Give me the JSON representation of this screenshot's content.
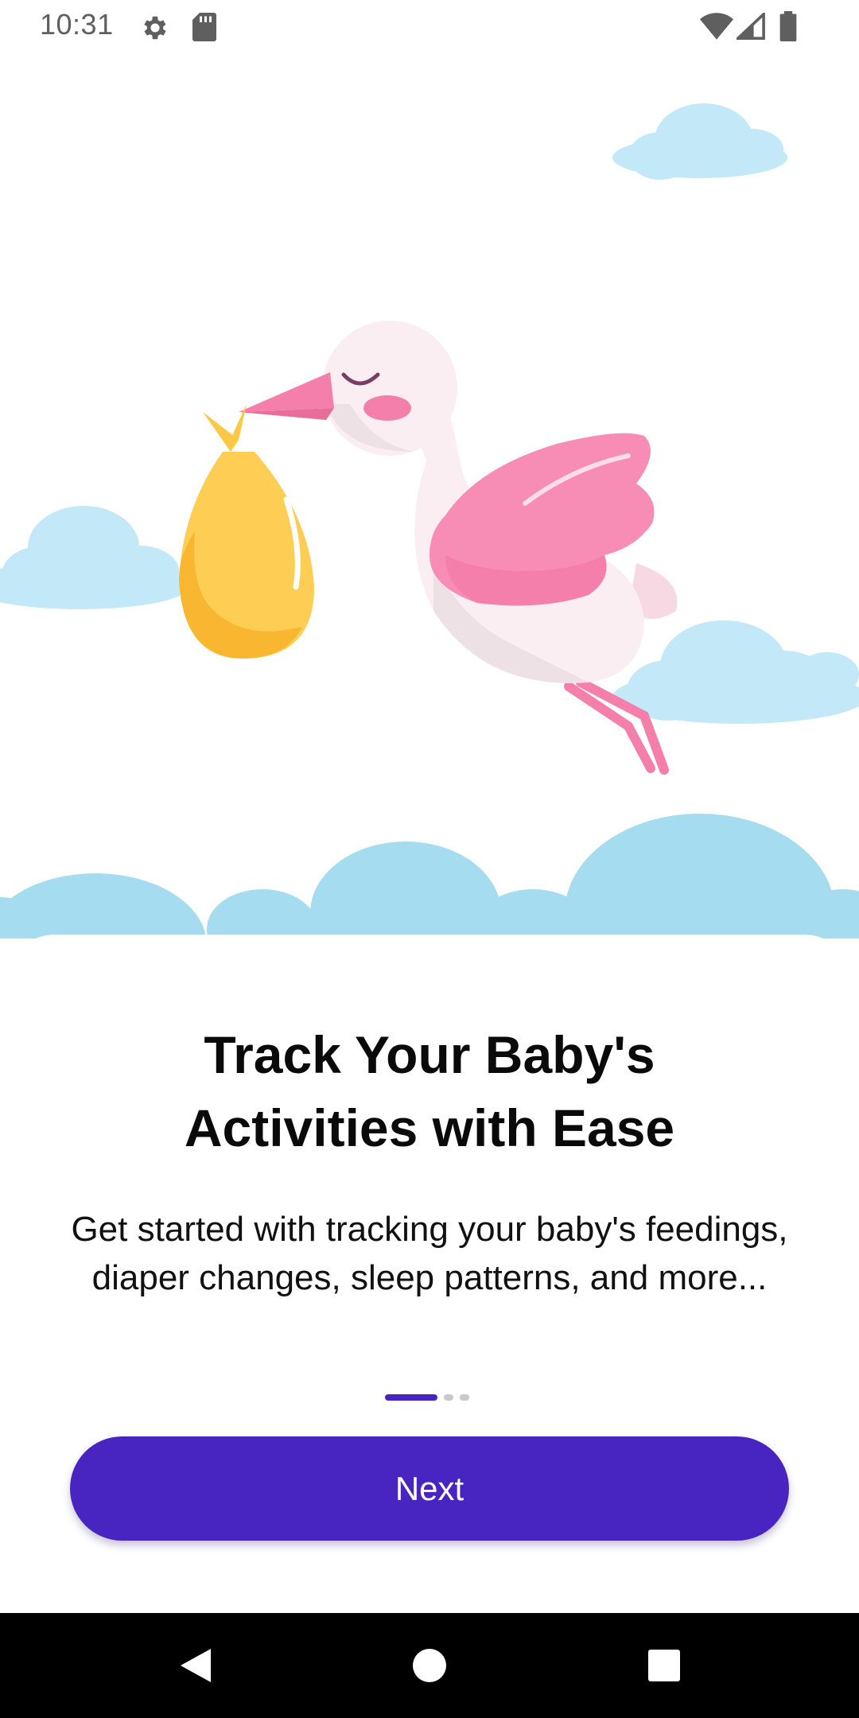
{
  "status_bar": {
    "time": "10:31",
    "icons": [
      "settings-gear-icon",
      "sd-card-icon",
      "wifi-icon",
      "cell-signal-icon",
      "battery-icon"
    ]
  },
  "hero": {
    "illustration": "stork-carrying-bundle-illustration",
    "colors": {
      "sky_cloud": "#c3e8f7",
      "bottom_cloud": "#a6dcef",
      "wing": "#f78db4",
      "bundle": "#fdce53"
    }
  },
  "onboarding": {
    "title_line1": "Track Your Baby's",
    "title_line2": "Activities with Ease",
    "subtitle": "Get started with tracking your baby's feedings, diaper changes, sleep patterns, and more...",
    "page_indicator": {
      "current": 1,
      "total": 3
    },
    "next_label": "Next"
  },
  "nav_bar": {
    "icons": [
      "back-triangle-icon",
      "home-circle-icon",
      "recents-square-icon"
    ]
  },
  "colors": {
    "accent": "#4824c1",
    "indicator_inactive": "#c9c9c9",
    "title": "#0a0a0a"
  }
}
